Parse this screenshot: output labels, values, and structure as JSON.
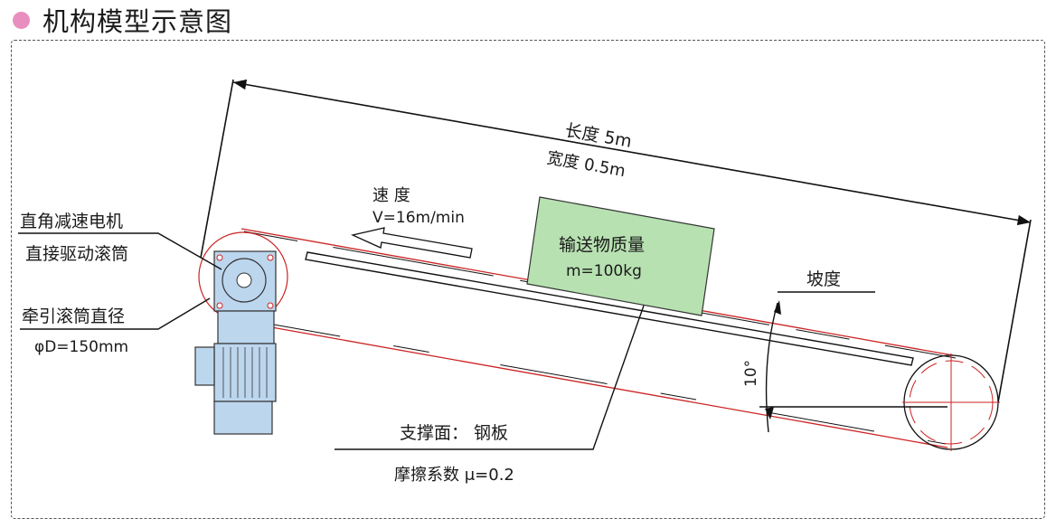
{
  "header": {
    "title": "机构模型示意图",
    "dot_color": "#e98fbf"
  },
  "labels": {
    "length": "长度 5m",
    "width": "宽度 0.5m",
    "speed_title": "速 度",
    "speed_value": "V=16m/min",
    "cargo_title": "输送物质量",
    "cargo_value": "m=100kg",
    "slope": "坡度",
    "angle": "10°",
    "motor_line1": "直角减速电机",
    "motor_line2": "直接驱动滚筒",
    "drum_line1": "牵引滚筒直径",
    "drum_line2": "φD=150mm",
    "support": "支撑面：  钢板",
    "friction": "摩擦系数 μ=0.2"
  },
  "colors": {
    "belt": "#cc2222",
    "cargo_fill": "#b7e1b1",
    "motor_fill": "#bcd6ee",
    "line": "#111111"
  }
}
